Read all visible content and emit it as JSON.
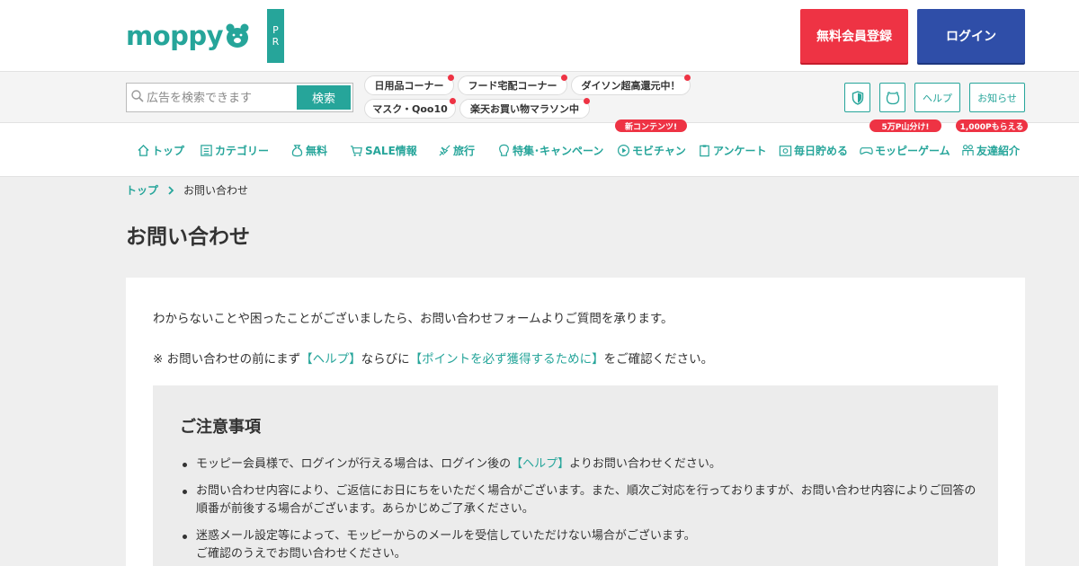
{
  "header": {
    "logo_text": "moppy",
    "pr_letters": [
      "P",
      "R"
    ],
    "register_label": "無料会員登録",
    "login_label": "ログイン"
  },
  "search": {
    "placeholder": "広告を検索できます",
    "button_label": "検索"
  },
  "tags": [
    {
      "label": "日用品コーナー"
    },
    {
      "label": "フード宅配コーナー"
    },
    {
      "label": "ダイソン超高還元中！"
    },
    {
      "label": "マスク・Qoo10"
    },
    {
      "label": "楽天お買い物マラソン中"
    }
  ],
  "utility": {
    "help_label": "ヘルプ",
    "news_label": "お知らせ"
  },
  "nav": {
    "items": [
      {
        "label": "トップ",
        "icon": "home-icon"
      },
      {
        "label": "カテゴリー",
        "icon": "list-icon"
      },
      {
        "label": "無料",
        "icon": "bag-icon"
      },
      {
        "label": "SALE情報",
        "icon": "cart-icon"
      },
      {
        "label": "旅行",
        "icon": "plane-icon"
      },
      {
        "label": "特集･キャンペーン",
        "icon": "gift-icon"
      },
      {
        "label": "モビチャン",
        "icon": "play-icon"
      },
      {
        "label": "アンケート",
        "icon": "clipboard-icon"
      },
      {
        "label": "毎日貯める",
        "icon": "coin-icon"
      },
      {
        "label": "モッピーゲーム",
        "icon": "gamepad-icon"
      },
      {
        "label": "友達紹介",
        "icon": "friends-icon"
      }
    ],
    "badges": {
      "mobichan": "新コンテンツ!",
      "game": "5万P山分け!",
      "friends": "1,000Pもらえる"
    }
  },
  "breadcrumb": {
    "home": "トップ",
    "current": "お問い合わせ"
  },
  "page": {
    "title": "お問い合わせ",
    "intro": "わからないことや困ったことがございましたら、お問い合わせフォームよりご質問を承ります。",
    "note_prefix": "※ お問い合わせの前にまず",
    "note_link_help": "【ヘルプ】",
    "note_middle": "ならびに",
    "note_link_points": "【ポイントを必ず獲得するために】",
    "note_suffix": "をご確認ください。"
  },
  "caution": {
    "title": "ご注意事項",
    "item1_prefix": "モッピー会員様で、ログインが行える場合は、ログイン後の",
    "item1_link": "【ヘルプ】",
    "item1_suffix": "よりお問い合わせください。",
    "item2": "お問い合わせ内容により、ご返信にお日にちをいただく場合がございます。また、順次ご対応を行っておりますが、お問い合わせ内容によりご回答の順番が前後する場合がございます。あらかじめご了承ください。",
    "item3_line1": "迷惑メール設定等によって、モッピーからのメールを受信していただけない場合がございます。",
    "item3_line2": "ご確認のうえでお問い合わせください。"
  },
  "colors": {
    "brand": "#26a59a",
    "register": "#ee3344",
    "login": "#2f4ea8",
    "badge": "#ee3344"
  }
}
